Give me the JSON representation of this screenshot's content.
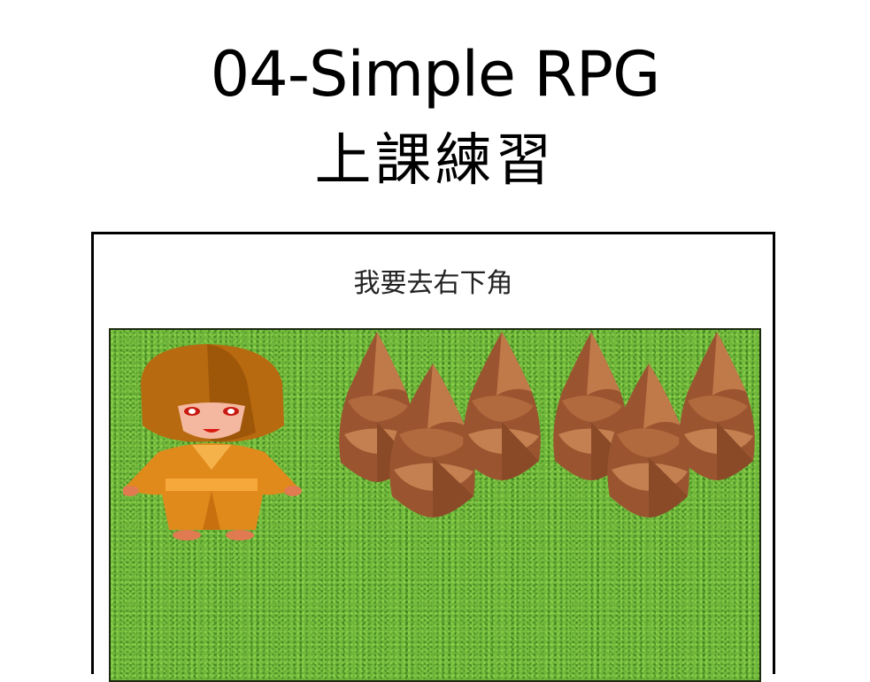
{
  "slide": {
    "title": "04-Simple RPG",
    "subtitle": "上課練習"
  },
  "game": {
    "message": "我要去右下角",
    "colors": {
      "grass": "#6fb63b",
      "monk_robe": "#e08a1c",
      "monk_hood": "#b86a10",
      "shoot": "#b06a3e"
    },
    "sprites": {
      "player": "monk-sprite",
      "obstacle": "bamboo-shoot-sprite"
    }
  }
}
